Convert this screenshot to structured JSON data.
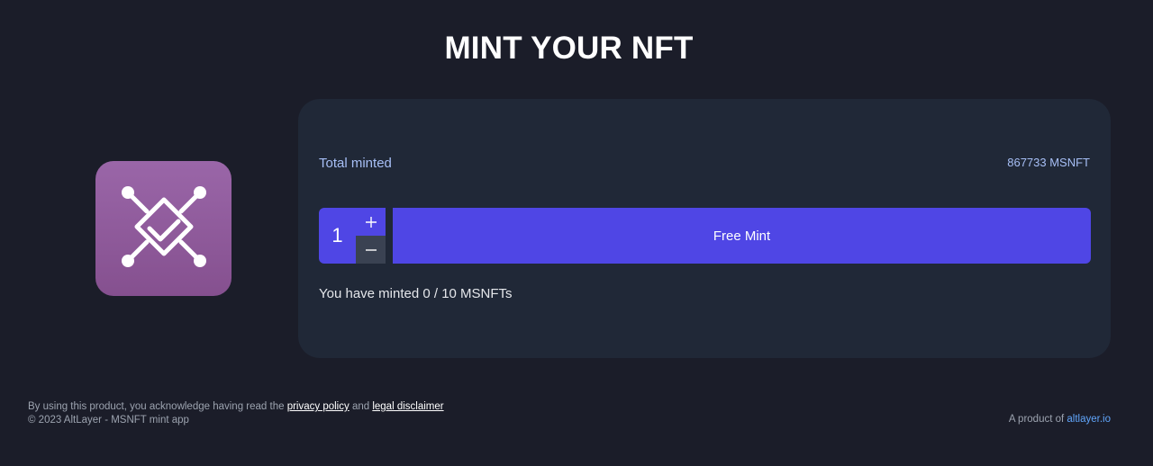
{
  "header": {
    "title": "MINT YOUR NFT"
  },
  "logo": {
    "icon": "chip-check-icon",
    "colors": {
      "tile": "#8f5aa0",
      "glyph": "#ffffff"
    }
  },
  "mint_panel": {
    "total_label": "Total minted",
    "total_value": "867733 MSNFT",
    "quantity": "1",
    "increment_symbol": "+",
    "decrement_symbol": "–",
    "mint_button_label": "Free Mint",
    "minted_status": "You have minted 0 / 10 MSNFTs"
  },
  "footer": {
    "notice_prefix": "By using this product, you acknowledge having read the",
    "privacy_link": "privacy policy",
    "notice_and": "and",
    "disclaimer_link": "legal disclaimer",
    "copyright": "© 2023 AltLayer - MSNFT mint app",
    "product_of": "A product of",
    "product_link": "altlayer.io"
  },
  "colors": {
    "background": "#1b1d29",
    "card": "#202837",
    "accent": "#4f46e5",
    "label": "#a7bff6",
    "link": "#60a5fa"
  }
}
